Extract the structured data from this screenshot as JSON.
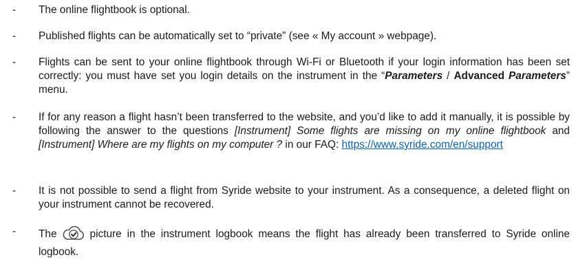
{
  "items": [
    {
      "text": "The online flightbook is optional."
    },
    {
      "text": "Published flights can be automatically set to “private” (see « My account » webpage)."
    },
    {
      "p1": "Flights can be sent to your online flightbook through Wi-Fi or Bluetooth if your login information has been set correctly: you must have set you login details on the instrument in the “",
      "parameters": "Parameters",
      "sep": " / ",
      "advanced": "Advanced",
      "parameters2": "Parameters",
      "p2": "” menu."
    },
    {
      "p1": "If for any reason a flight hasn’t been transferred to the website, and you’d like to add it manually, it is possible by following the answer to the questions ",
      "q1": "[Instrument] Some flights are missing on my online flightbook",
      "p2": " and ",
      "q2": "[Instrument] Where are my flights on my computer ?",
      "p3": " in our FAQ: ",
      "link": "https://www.syride.com/en/support"
    },
    {
      "text": "It is not possible to send a flight from Syride website to your instrument. As a consequence, a deleted flight on your instrument cannot be recovered."
    },
    {
      "p1": "The",
      "icon": "cloud-check-icon",
      "p2": "picture in the instrument logbook means the flight has already been transferred to Syride online logbook."
    }
  ],
  "dash": "-"
}
